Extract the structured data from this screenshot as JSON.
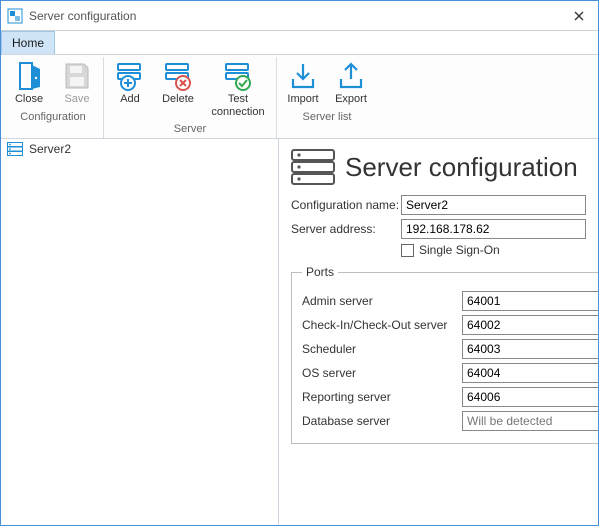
{
  "window": {
    "title": "Server configuration",
    "close": "✕"
  },
  "tab": {
    "home": "Home"
  },
  "ribbon": {
    "configuration": {
      "label": "Configuration",
      "close": "Close",
      "save": "Save"
    },
    "server": {
      "label": "Server",
      "add": "Add",
      "delete": "Delete",
      "test": "Test connection"
    },
    "serverlist": {
      "label": "Server list",
      "import": "Import",
      "export": "Export"
    }
  },
  "sidebar": {
    "items": [
      {
        "label": "Server2"
      }
    ]
  },
  "main": {
    "title": "Server configuration",
    "config_name_label": "Configuration name:",
    "config_name_value": "Server2",
    "server_addr_label": "Server address:",
    "server_addr_value": "192.168.178.62",
    "sso_label": "Single Sign-On",
    "ports_legend": "Ports",
    "ports": {
      "admin": {
        "label": "Admin server",
        "value": "64001"
      },
      "cico": {
        "label": "Check-In/Check-Out server",
        "value": "64002"
      },
      "scheduler": {
        "label": "Scheduler",
        "value": "64003"
      },
      "os": {
        "label": "OS server",
        "value": "64004"
      },
      "reporting": {
        "label": "Reporting server",
        "value": "64006"
      },
      "database": {
        "label": "Database server",
        "placeholder": "Will be detected"
      }
    }
  },
  "colors": {
    "accent": "#1e8fd6",
    "green": "#2fa84f",
    "red": "#d9534f"
  }
}
